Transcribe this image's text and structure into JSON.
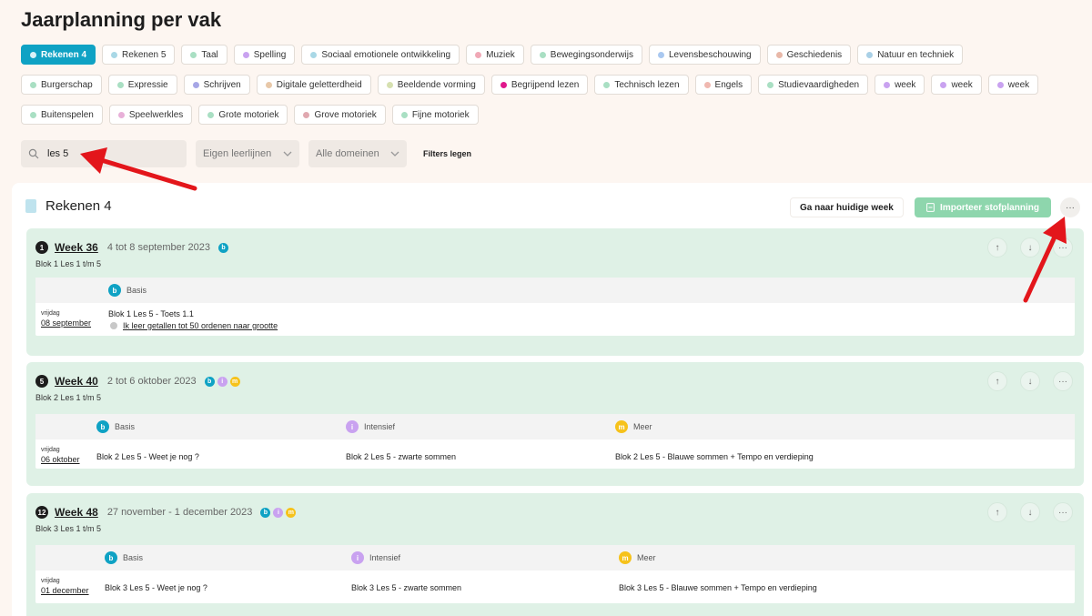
{
  "page_title": "Jaarplanning per vak",
  "chips": [
    [
      {
        "label": "Rekenen 4",
        "color": "#d9f1f7",
        "active": true
      },
      {
        "label": "Rekenen 5",
        "color": "#a9d8e6"
      },
      {
        "label": "Taal",
        "color": "#a9dfc3"
      },
      {
        "label": "Spelling",
        "color": "#c9a2f0"
      },
      {
        "label": "Sociaal emotionele ontwikkeling",
        "color": "#a9d8e6"
      },
      {
        "label": "Muziek",
        "color": "#f0a8b6"
      },
      {
        "label": "Bewegingsonderwijs",
        "color": "#a9dfc3"
      },
      {
        "label": "Levensbeschouwing",
        "color": "#a9c8f0"
      },
      {
        "label": "Geschiedenis",
        "color": "#e8b8a8"
      },
      {
        "label": "Natuur en techniek",
        "color": "#a9d0e6"
      }
    ],
    [
      {
        "label": "Burgerschap",
        "color": "#a9dfc3"
      },
      {
        "label": "Expressie",
        "color": "#a9dfc3"
      },
      {
        "label": "Schrijven",
        "color": "#a6a6e6"
      },
      {
        "label": "Digitale geletterdheid",
        "color": "#e8c8a8"
      },
      {
        "label": "Beeldende vorming",
        "color": "#d6e0b0"
      },
      {
        "label": "Begrijpend lezen",
        "color": "#e0188c"
      },
      {
        "label": "Technisch lezen",
        "color": "#a9dfc3"
      },
      {
        "label": "Engels",
        "color": "#f0b8b0"
      },
      {
        "label": "Studievaardigheden",
        "color": "#a9dfc3"
      },
      {
        "label": "week",
        "color": "#c9a2f0"
      },
      {
        "label": "week",
        "color": "#c9a2f0"
      },
      {
        "label": "week",
        "color": "#c9a2f0"
      }
    ],
    [
      {
        "label": "Buitenspelen",
        "color": "#a9dfc3"
      },
      {
        "label": "Speelwerkles",
        "color": "#e8b0d8"
      },
      {
        "label": "Grote motoriek",
        "color": "#a9dfc3"
      },
      {
        "label": "Grove motoriek",
        "color": "#e0a8b0"
      },
      {
        "label": "Fijne motoriek",
        "color": "#a9dfc3"
      }
    ]
  ],
  "filters": {
    "search_value": "les 5",
    "leerlijnen": "Eigen leerlijnen",
    "domeinen": "Alle domeinen",
    "clear": "Filters legen"
  },
  "panel": {
    "title": "Rekenen 4",
    "btn_current_week": "Ga naar huidige week",
    "btn_import": "Importeer stofplanning",
    "more": "···"
  },
  "weeks": [
    {
      "num": "1",
      "label": "Week 36",
      "dates": "4 tot 8 september 2023",
      "badges": [
        "b"
      ],
      "sub": "Blok 1 Les 1 t/m 5",
      "columns": [
        {
          "badge": "b",
          "name": "Basis"
        }
      ],
      "day_name": "vrijdag",
      "day_date": "08 september",
      "cells": [
        "Blok 1 Les 5 - Toets 1.1"
      ],
      "goal": "Ik leer getallen tot 50 ordenen naar grootte"
    },
    {
      "num": "5",
      "label": "Week 40",
      "dates": "2 tot 6 oktober 2023",
      "badges": [
        "b",
        "i",
        "m"
      ],
      "sub": "Blok 2 Les 1 t/m 5",
      "columns": [
        {
          "badge": "b",
          "name": "Basis"
        },
        {
          "badge": "i",
          "name": "Intensief"
        },
        {
          "badge": "m",
          "name": "Meer"
        }
      ],
      "day_name": "vrijdag",
      "day_date": "06 oktober",
      "cells": [
        "Blok 2 Les 5 - Weet je nog ?",
        "Blok 2 Les 5 - zwarte sommen",
        "Blok 2 Les 5 - Blauwe sommen + Tempo en verdieping"
      ]
    },
    {
      "num": "12",
      "label": "Week 48",
      "dates": "27 november - 1 december 2023",
      "badges": [
        "b",
        "i",
        "m"
      ],
      "sub": "Blok 3 Les 1 t/m 5",
      "columns": [
        {
          "badge": "b",
          "name": "Basis"
        },
        {
          "badge": "i",
          "name": "Intensief"
        },
        {
          "badge": "m",
          "name": "Meer"
        }
      ],
      "day_name": "vrijdag",
      "day_date": "01 december",
      "cells": [
        "Blok 3 Les 5 - Weet je nog ?",
        "Blok 3 Les 5 - zwarte sommen",
        "Blok 3 Les 5 - Blauwe sommen + Tempo en verdieping"
      ]
    }
  ],
  "icons": {
    "search": "search-icon",
    "chevron": "chevron-down-icon",
    "arrow_up": "arrow-up-icon",
    "arrow_down": "arrow-down-icon",
    "more": "more-icon",
    "document": "document-icon"
  },
  "colors": {
    "accent": "#0fa2c4",
    "card_bg": "#dff1e6",
    "import_btn": "#8ed6ad",
    "annotation_arrow": "#e3161b"
  }
}
